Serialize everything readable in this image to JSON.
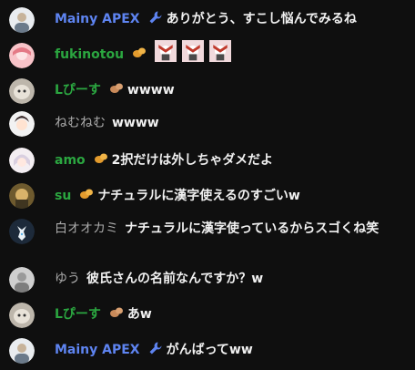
{
  "messages": [
    {
      "author": "Mainy APEX",
      "text": "ありがとう、すこし悩んでみるね"
    },
    {
      "author": "fukinotou",
      "text": ""
    },
    {
      "author": "Lぴーす",
      "text": "wwww"
    },
    {
      "author": "ねむねむ",
      "text": "wwww"
    },
    {
      "author": "amo",
      "text": "2択だけは外しちゃダメだよ"
    },
    {
      "author": "su",
      "text": "ナチュラルに漢字使えるのすごいw"
    },
    {
      "author": "白オオカミ",
      "text": "ナチュラルに漢字使っているからスゴくね笑"
    },
    {
      "author": "ゆう",
      "text": "彼氏さんの名前なんですか？w"
    },
    {
      "author": "Lぴーす",
      "text": "あw"
    },
    {
      "author": "Mainy APEX",
      "text": "がんばってww"
    }
  ],
  "colors": {
    "background": "#0f0f0f",
    "member_name": "#2ba640",
    "moderator_name": "#5e84f1",
    "normal_name": "#aaaaaa",
    "message_text": "#f1f1f1"
  },
  "icons": {
    "moderator_badge": "wrench-icon",
    "member_badge": "potato-icon",
    "stamp": "character-stamp-icon"
  }
}
